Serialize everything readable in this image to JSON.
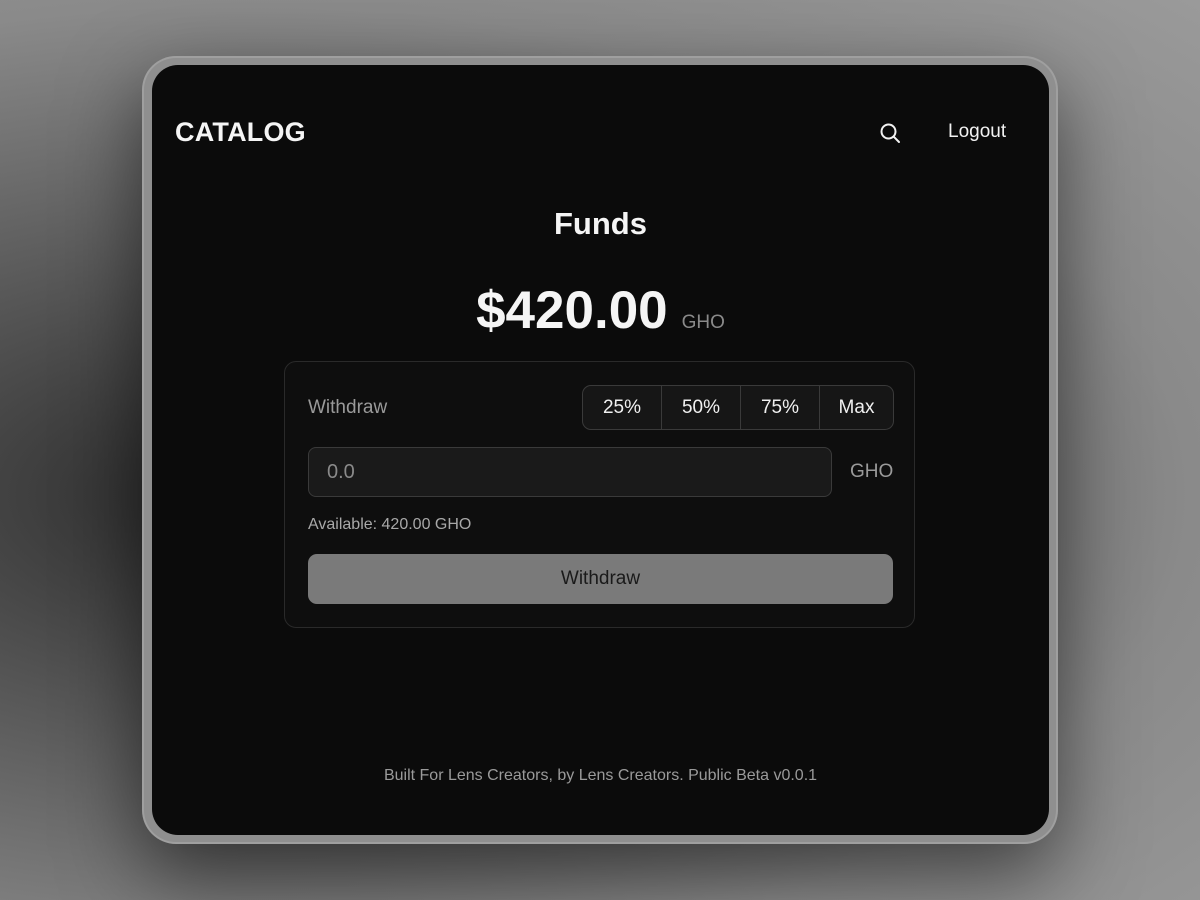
{
  "header": {
    "brand": "CATALOG",
    "search_icon": "search-icon",
    "logout_label": "Logout"
  },
  "main": {
    "title": "Funds",
    "balance": {
      "amount": "$420.00",
      "unit": "GHO"
    },
    "withdraw_card": {
      "label": "Withdraw",
      "percent_options": [
        "25%",
        "50%",
        "75%",
        "Max"
      ],
      "input": {
        "value": "",
        "placeholder": "0.0",
        "unit": "GHO"
      },
      "available_text": "Available: 420.00 GHO",
      "submit_label": "Withdraw"
    }
  },
  "footer": {
    "text": "Built For Lens Creators, by Lens Creators. Public Beta v0.0.1"
  },
  "colors": {
    "background": "#0b0b0b",
    "button_disabled": "#7a7a7a",
    "muted_text": "#9a9a9a"
  }
}
